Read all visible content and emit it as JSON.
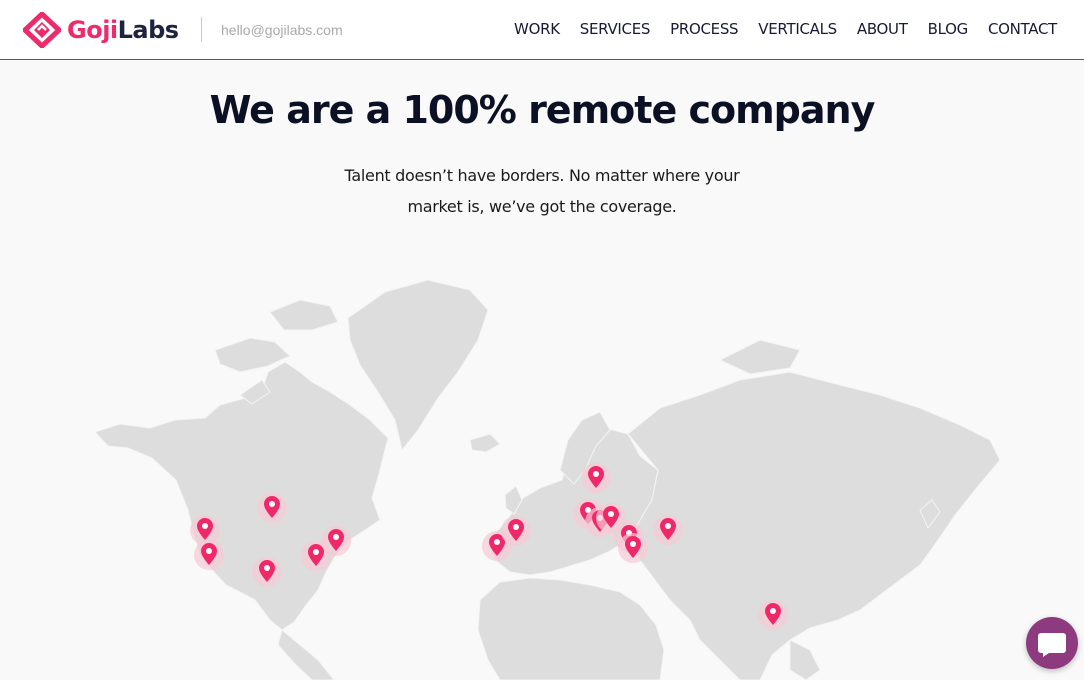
{
  "header": {
    "logo": {
      "part1": "Goji",
      "part2": "Labs",
      "icon": "gojilabs-diamond-logo"
    },
    "email": "hello@gojilabs.com",
    "nav": [
      "WORK",
      "SERVICES",
      "PROCESS",
      "VERTICALS",
      "ABOUT",
      "BLOG",
      "CONTACT"
    ]
  },
  "hero": {
    "title": "We are a 100% remote company",
    "subtitle_line1": "Talent doesn’t have borders. No matter where your",
    "subtitle_line2": "market is, we’ve got the coverage."
  },
  "map": {
    "icon": "world-map",
    "marker_icon": "location-pin-icon",
    "marker_color": "#f0286a",
    "land_color": "#dddddd",
    "marker_count": 18
  },
  "chat_widget": {
    "icon": "chat-bubble-icon",
    "color": "#8e3a7e"
  },
  "colors": {
    "brand_pink": "#ee2a6b",
    "brand_navy": "#1d2340"
  }
}
